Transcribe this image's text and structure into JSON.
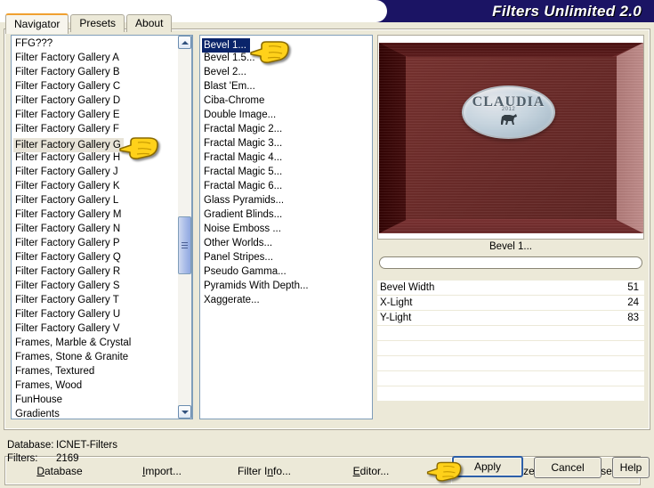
{
  "window": {
    "title": "Filters Unlimited 2.0",
    "accent_blue": "#1b1464",
    "tab_active_accent": "#f0a030",
    "selection_blue": "#0a246a"
  },
  "tabs": [
    {
      "label": "Navigator",
      "active": true
    },
    {
      "label": "Presets",
      "active": false
    },
    {
      "label": "About",
      "active": false
    }
  ],
  "category_list": {
    "selected": "Filter Factory Gallery G",
    "items": [
      "FFG???",
      "Filter Factory Gallery A",
      "Filter Factory Gallery B",
      "Filter Factory Gallery C",
      "Filter Factory Gallery D",
      "Filter Factory Gallery E",
      "Filter Factory Gallery F",
      "Filter Factory Gallery G",
      "Filter Factory Gallery H",
      "Filter Factory Gallery J",
      "Filter Factory Gallery K",
      "Filter Factory Gallery L",
      "Filter Factory Gallery M",
      "Filter Factory Gallery N",
      "Filter Factory Gallery P",
      "Filter Factory Gallery Q",
      "Filter Factory Gallery R",
      "Filter Factory Gallery S",
      "Filter Factory Gallery T",
      "Filter Factory Gallery U",
      "Filter Factory Gallery V",
      "Frames, Marble & Crystal",
      "Frames, Stone & Granite",
      "Frames, Textured",
      "Frames, Wood",
      "FunHouse",
      "Gradients"
    ]
  },
  "filter_list": {
    "selected": "Bevel 1...",
    "items": [
      "Bevel 1...",
      "Bevel 1.5...",
      "Bevel 2...",
      "Blast 'Em...",
      "Ciba-Chrome",
      "Double Image...",
      "Fractal Magic 2...",
      "Fractal Magic 3...",
      "Fractal Magic 4...",
      "Fractal Magic 5...",
      "Fractal Magic 6...",
      "Glass Pyramids...",
      "Gradient Blinds...",
      "Noise Emboss ...",
      "Other Worlds...",
      "Panel Stripes...",
      "Pseudo Gamma...",
      "Pyramids With Depth...",
      "Xaggerate..."
    ]
  },
  "preview": {
    "effect_name": "Bevel 1...",
    "base_color": "#6e2a2a",
    "highlight_color": "#c08d8b",
    "shadow_color": "#330404"
  },
  "parameters": {
    "title": "Bevel 1...",
    "rows": [
      {
        "name": "Bevel Width",
        "value": "51"
      },
      {
        "name": "X-Light",
        "value": "24"
      },
      {
        "name": "Y-Light",
        "value": "83"
      },
      {
        "name": "",
        "value": ""
      },
      {
        "name": "",
        "value": ""
      },
      {
        "name": "",
        "value": ""
      },
      {
        "name": "",
        "value": ""
      },
      {
        "name": "",
        "value": ""
      }
    ]
  },
  "watermark": {
    "text": "CLAUDIA",
    "sub": "2012",
    "dog_glyph": "&"
  },
  "command_bar": {
    "left": [
      {
        "label": "Database",
        "accel": "D"
      },
      {
        "label": "Import...",
        "accel": "I"
      },
      {
        "label": "Filter Info...",
        "accel": "n"
      },
      {
        "label": "Editor...",
        "accel": "E"
      }
    ],
    "right": [
      {
        "label": "Randomize"
      },
      {
        "label": "Reset"
      }
    ]
  },
  "status": {
    "database_label": "Database:",
    "database_value": "ICNET-Filters",
    "filters_label": "Filters:",
    "filters_value": "2169"
  },
  "dialog_buttons": [
    {
      "label": "Apply",
      "default": true
    },
    {
      "label": "Cancel",
      "default": false
    },
    {
      "label": "Help",
      "default": false
    }
  ],
  "cursors": {
    "icon": "pointing-hand"
  }
}
